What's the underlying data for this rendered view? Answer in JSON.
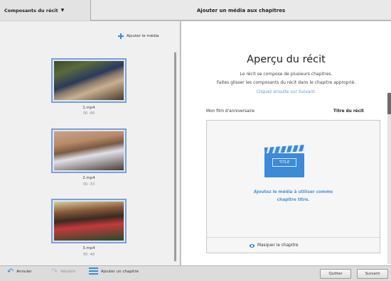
{
  "header": {
    "left_title": "Composants du récit",
    "main_title": "Ajouter un média aux chapitres"
  },
  "media_panel": {
    "add_media_label": "Ajouter le média",
    "clips": [
      {
        "name": "1.mp4",
        "duration": "00 :48"
      },
      {
        "name": "2.mp4",
        "duration": "00 :33"
      },
      {
        "name": "3.mp4",
        "duration": "00 :48"
      }
    ]
  },
  "story_preview": {
    "title": "Aperçu du récit",
    "line1": "Le récit se compose de plusieurs chapitres.",
    "line2": "Faites glisser les composants du récit dans le chapitre approprié.",
    "line3": "Cliquez ensuite sur Suivant.",
    "film_name": "Mon film d'anniversaire",
    "chapter_label": "Titre du récit",
    "clapper_text": "TITLE",
    "drop_line1": "Ajoutez le média à utiliser comme",
    "drop_line2": "chapitre titre.",
    "hide_chapter": "Masquer le chapitre"
  },
  "footer": {
    "undo": "Annuler",
    "redo": "Rétablir",
    "add_chapter": "Ajouter un chapitre",
    "quit": "Quitter",
    "next": "Suivant"
  },
  "colors": {
    "accent": "#3c8ad8",
    "link": "#5b9ad8"
  },
  "icons": {
    "caret": "caret-down-icon",
    "add": "plus-icon",
    "clapper": "clapperboard-icon",
    "eye": "eye-icon",
    "undo": "undo-icon",
    "redo": "redo-icon",
    "add_chapter": "add-chapter-icon"
  }
}
